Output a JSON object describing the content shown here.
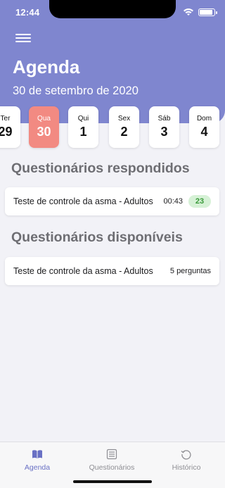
{
  "status_bar": {
    "time": "12:44"
  },
  "header": {
    "title": "Agenda",
    "date": "30 de setembro de 2020"
  },
  "days": [
    {
      "name": "Ter",
      "num": "29"
    },
    {
      "name": "Qua",
      "num": "30",
      "selected": true
    },
    {
      "name": "Qui",
      "num": "1"
    },
    {
      "name": "Sex",
      "num": "2"
    },
    {
      "name": "Sáb",
      "num": "3"
    },
    {
      "name": "Dom",
      "num": "4"
    }
  ],
  "answered": {
    "title": "Questionários respondidos",
    "items": [
      {
        "name": "Teste de controle da asma - Adultos",
        "duration": "00:43",
        "score": "23"
      }
    ]
  },
  "available": {
    "title": "Questionários disponíveis",
    "items": [
      {
        "name": "Teste de controle da asma - Adultos",
        "questions": "5 perguntas"
      }
    ]
  },
  "tabs": [
    {
      "label": "Agenda",
      "icon": "book-icon",
      "active": true
    },
    {
      "label": "Questionários",
      "icon": "list-icon",
      "active": false
    },
    {
      "label": "Histórico",
      "icon": "history-icon",
      "active": false
    }
  ],
  "colors": {
    "header": "#7f86cf",
    "selected_day": "#f28a82",
    "score_bg": "#d6f1d6",
    "score_text": "#3a9a3a",
    "active_tab": "#6970c4"
  }
}
